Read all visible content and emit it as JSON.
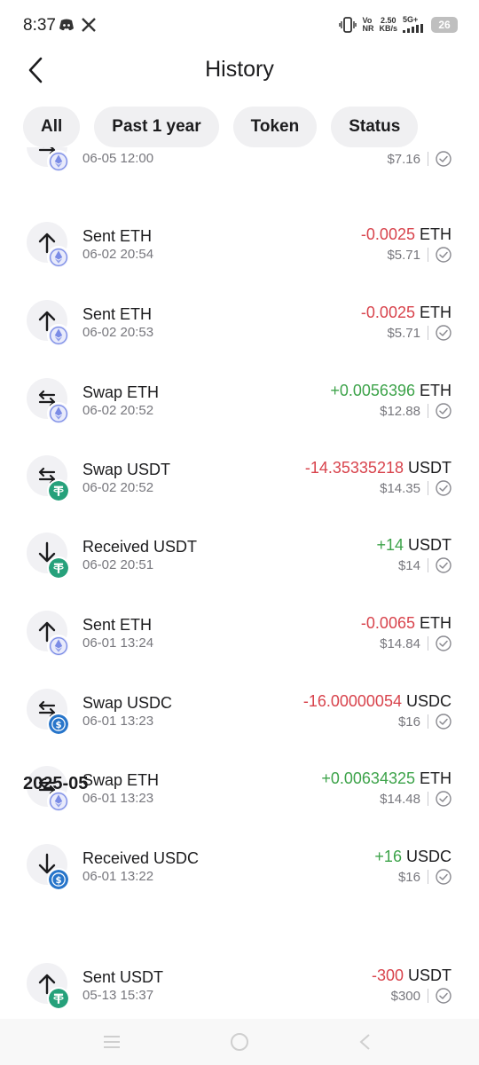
{
  "status_bar": {
    "time": "8:37",
    "net_top": "Vo",
    "net_bottom": "NR",
    "speed_top": "2.50",
    "speed_bottom": "KB/s",
    "network": "5G+",
    "battery": "26"
  },
  "header": {
    "title": "History"
  },
  "filters": [
    "All",
    "Past 1 year",
    "Token",
    "Status"
  ],
  "transactions": [
    {
      "title": "",
      "time": "06-05 12:00",
      "amount": "",
      "unit": "",
      "sign": "",
      "usd": "$7.16",
      "direction": "swap",
      "token": "eth"
    },
    {
      "title": "Sent ETH",
      "time": "06-02 20:54",
      "amount": "-0.0025",
      "unit": "ETH",
      "sign": "neg",
      "usd": "$5.71",
      "direction": "up",
      "token": "eth"
    },
    {
      "title": "Sent ETH",
      "time": "06-02 20:53",
      "amount": "-0.0025",
      "unit": "ETH",
      "sign": "neg",
      "usd": "$5.71",
      "direction": "up",
      "token": "eth"
    },
    {
      "title": "Swap ETH",
      "time": "06-02 20:52",
      "amount": "+0.0056396",
      "unit": "ETH",
      "sign": "pos",
      "usd": "$12.88",
      "direction": "swap",
      "token": "eth"
    },
    {
      "title": "Swap USDT",
      "time": "06-02 20:52",
      "amount": "-14.35335218",
      "unit": "USDT",
      "sign": "neg",
      "usd": "$14.35",
      "direction": "swap",
      "token": "usdt"
    },
    {
      "title": "Received USDT",
      "time": "06-02 20:51",
      "amount": "+14",
      "unit": "USDT",
      "sign": "pos",
      "usd": "$14",
      "direction": "down",
      "token": "usdt"
    },
    {
      "title": "Sent ETH",
      "time": "06-01 13:24",
      "amount": "-0.0065",
      "unit": "ETH",
      "sign": "neg",
      "usd": "$14.84",
      "direction": "up",
      "token": "eth"
    },
    {
      "title": "Swap USDC",
      "time": "06-01 13:23",
      "amount": "-16.00000054",
      "unit": "USDC",
      "sign": "neg",
      "usd": "$16",
      "direction": "swap",
      "token": "usdc"
    },
    {
      "title": "Swap ETH",
      "time": "06-01 13:23",
      "amount": "+0.00634325",
      "unit": "ETH",
      "sign": "pos",
      "usd": "$14.48",
      "direction": "swap",
      "token": "eth"
    },
    {
      "title": "Received USDC",
      "time": "06-01 13:22",
      "amount": "+16",
      "unit": "USDC",
      "sign": "pos",
      "usd": "$16",
      "direction": "down",
      "token": "usdc"
    },
    {
      "title": "Sent USDT",
      "time": "05-13 15:37",
      "amount": "-300",
      "unit": "USDT",
      "sign": "neg",
      "usd": "$300",
      "direction": "up",
      "token": "usdt"
    }
  ],
  "section_title": "2025-05",
  "colors": {
    "negative": "#d8434c",
    "positive": "#3da34a",
    "usdt": "#26a17b",
    "usdc": "#2775ca",
    "eth": "#7b8ce6"
  }
}
